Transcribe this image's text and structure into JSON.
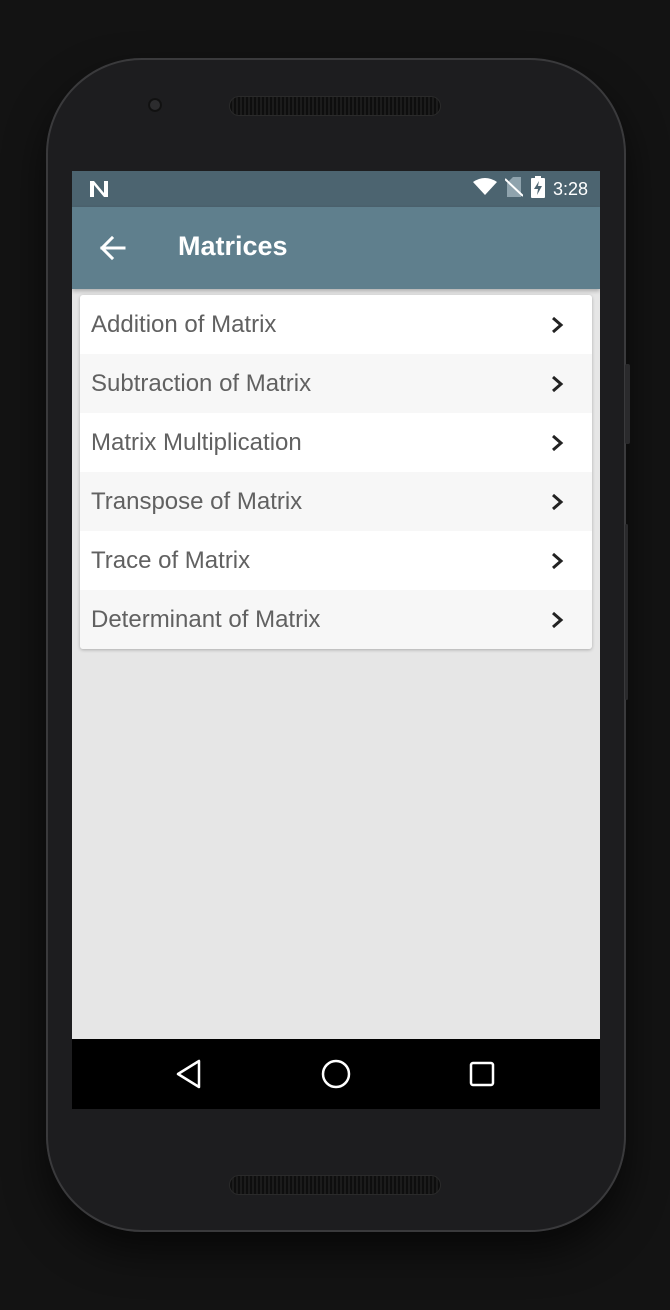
{
  "status_bar": {
    "notification_icon": "n-icon",
    "time": "3:28"
  },
  "app_bar": {
    "title": "Matrices",
    "back_icon": "arrow-left-icon"
  },
  "list": {
    "items": [
      {
        "label": "Addition of Matrix"
      },
      {
        "label": "Subtraction of Matrix"
      },
      {
        "label": "Matrix Multiplication"
      },
      {
        "label": "Transpose of Matrix"
      },
      {
        "label": "Trace of Matrix"
      },
      {
        "label": "Determinant of Matrix"
      }
    ]
  },
  "nav_bar": {
    "back_icon": "triangle-back-icon",
    "home_icon": "circle-home-icon",
    "recents_icon": "square-recents-icon"
  },
  "colors": {
    "status_bar": "#4c6470",
    "app_bar": "#5f7f8d",
    "background": "#e6e6e6",
    "item_text": "#616161"
  }
}
